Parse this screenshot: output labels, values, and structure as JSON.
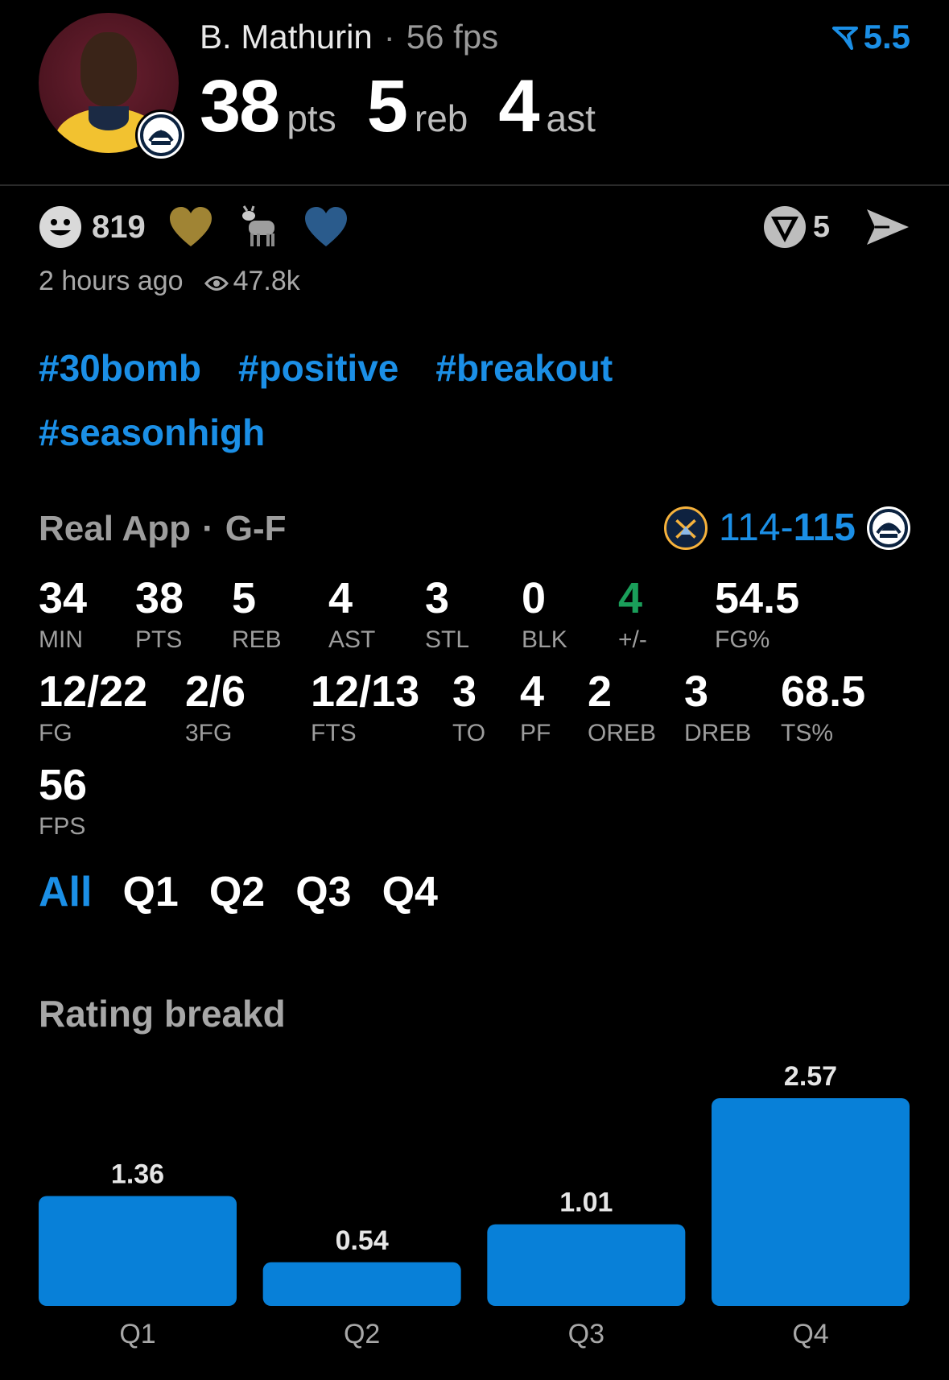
{
  "header": {
    "player_name": "B. Mathurin",
    "separator": "·",
    "fps_text": "56 fps",
    "rating": "5.5",
    "stats": [
      {
        "value": "38",
        "unit": "pts"
      },
      {
        "value": "5",
        "unit": "reb"
      },
      {
        "value": "4",
        "unit": "ast"
      }
    ]
  },
  "reactions": {
    "smile_count": "819",
    "icons": [
      "smile-icon",
      "gold-heart-icon",
      "goat-icon",
      "blue-heart-icon"
    ],
    "vote_count": "5"
  },
  "meta": {
    "time_ago": "2 hours ago",
    "views": "47.8k"
  },
  "hashtags": [
    "#30bomb",
    "#positive",
    "#breakout",
    "#seasonhigh"
  ],
  "game": {
    "app": "Real App",
    "separator": "·",
    "position": "G-F",
    "score_away": "114-",
    "score_home": "115"
  },
  "stats": [
    {
      "value": "34",
      "label": "MIN"
    },
    {
      "value": "38",
      "label": "PTS"
    },
    {
      "value": "5",
      "label": "REB"
    },
    {
      "value": "4",
      "label": "AST"
    },
    {
      "value": "3",
      "label": "STL"
    },
    {
      "value": "0",
      "label": "BLK"
    },
    {
      "value": "4",
      "label": "+/-"
    },
    {
      "value": "54.5",
      "label": "FG%"
    },
    {
      "value": "12/22",
      "label": "FG"
    },
    {
      "value": "2/6",
      "label": "3FG"
    },
    {
      "value": "12/13",
      "label": "FTS"
    },
    {
      "value": "3",
      "label": "TO"
    },
    {
      "value": "4",
      "label": "PF"
    },
    {
      "value": "2",
      "label": "OREB"
    },
    {
      "value": "3",
      "label": "DREB"
    },
    {
      "value": "68.5",
      "label": "TS%"
    },
    {
      "value": "56",
      "label": "FPS"
    }
  ],
  "quarter_tabs": [
    {
      "label": "All",
      "active": true
    },
    {
      "label": "Q1",
      "active": false
    },
    {
      "label": "Q2",
      "active": false
    },
    {
      "label": "Q3",
      "active": false
    },
    {
      "label": "Q4",
      "active": false
    }
  ],
  "rating_title": "Rating breakd",
  "colors": {
    "accent": "#1b8fe6",
    "bar": "#0880d8",
    "positive": "#1a9e5a"
  },
  "chart_data": {
    "type": "bar",
    "categories": [
      "Q1",
      "Q2",
      "Q3",
      "Q4"
    ],
    "values": [
      1.36,
      0.54,
      1.01,
      2.57
    ],
    "title": "",
    "xlabel": "",
    "ylabel": "",
    "grid": false
  }
}
